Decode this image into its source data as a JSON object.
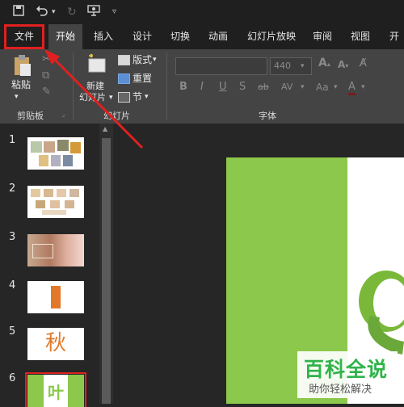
{
  "quick_access": {
    "icons": [
      "save-icon",
      "undo-icon",
      "redo-icon",
      "present-icon",
      "customize-icon"
    ]
  },
  "tabs": [
    "文件",
    "开始",
    "插入",
    "设计",
    "切换",
    "动画",
    "幻灯片放映",
    "审阅",
    "视图",
    "开发"
  ],
  "active_tab": "开始",
  "highlighted_tab": "文件",
  "ribbon": {
    "clipboard": {
      "paste": "粘贴",
      "group_label": "剪贴板"
    },
    "slides": {
      "new_slide_line1": "新建",
      "new_slide_line2": "幻灯片",
      "layout": "版式",
      "reset": "重置",
      "section": "节",
      "group_label": "幻灯片"
    },
    "font": {
      "font_size": "440",
      "group_label": "字体",
      "buttons": [
        "B",
        "I",
        "U",
        "S",
        "ab",
        "AV",
        "Aa",
        "A"
      ]
    }
  },
  "slides_panel": {
    "numbers": [
      "1",
      "2",
      "3",
      "4",
      "5",
      "6"
    ],
    "slide5_text": "秋",
    "slide6_text": "叶"
  },
  "watermark": {
    "title": "百科全说",
    "subtitle": "助你轻松解决"
  },
  "colors": {
    "accent_green": "#8cc84b",
    "highlight_red": "#e02020",
    "orange": "#e07a2a"
  }
}
